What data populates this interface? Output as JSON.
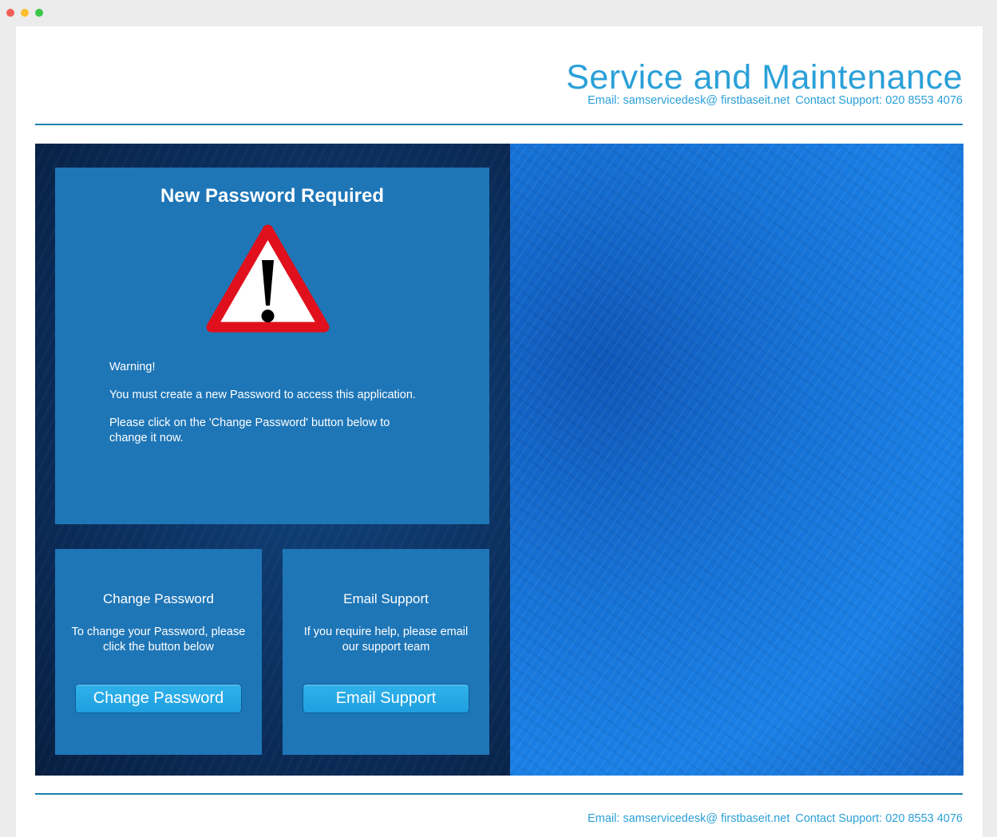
{
  "header": {
    "title": "Service and Maintenance",
    "email_label": "Email: samservicedesk@ firstbaseit.net",
    "contact_label": "Contact Support: 020 8553 4076"
  },
  "main_panel": {
    "title": "New Password Required",
    "icon": "warning-triangle-icon",
    "warning_label": "Warning!",
    "message_line": "You must create a new Password to access this application.",
    "instruction": "Please click on the 'Change Password' button below to change it now."
  },
  "change_card": {
    "title": "Change Password",
    "text": "To change your Password, please click the button below",
    "button_label": "Change Password"
  },
  "email_card": {
    "title": "Email Support",
    "text": "If you require help, please email our support team",
    "button_label": "Email Support"
  },
  "footer": {
    "email_label": "Email: samservicedesk@ firstbaseit.net",
    "contact_label": "Contact Support: 020 8553 4076"
  },
  "colors": {
    "accent": "#2aa0d8",
    "panel": "#1e76b7",
    "button": "#24a6e4",
    "warning_red": "#e0101c"
  }
}
